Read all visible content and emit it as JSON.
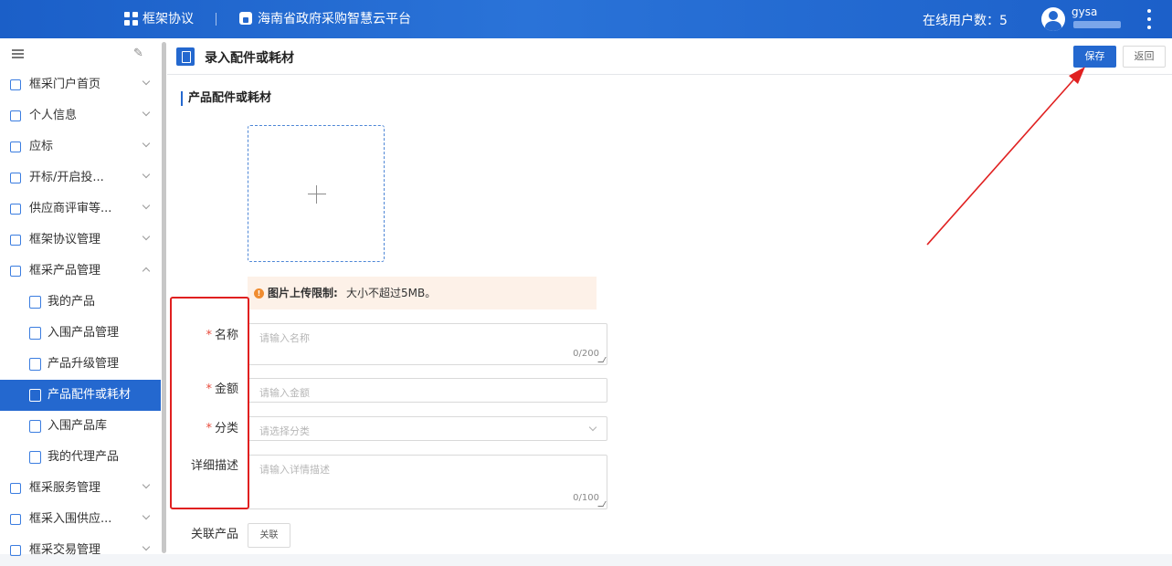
{
  "topbar": {
    "app_name": "框架协议",
    "platform_name": "海南省政府采购智慧云平台",
    "online_users": "在线用户数：5",
    "username": "gysa"
  },
  "sidebar": {
    "items": [
      {
        "label": "框采门户首页",
        "icon": "home-grid-icon"
      },
      {
        "label": "个人信息",
        "icon": "user-card-icon"
      },
      {
        "label": "应标",
        "icon": "bid-icon"
      },
      {
        "label": "开标/开启投...",
        "icon": "open-bid-icon"
      },
      {
        "label": "供应商评审等...",
        "icon": "review-icon"
      },
      {
        "label": "框架协议管理",
        "icon": "agreement-icon"
      },
      {
        "label": "框采产品管理",
        "icon": "product-icon"
      }
    ],
    "subitems": [
      {
        "label": "我的产品",
        "icon": "my-product-icon"
      },
      {
        "label": "入围产品管理",
        "icon": "shortlist-manage-icon"
      },
      {
        "label": "产品升级管理",
        "icon": "upgrade-icon"
      },
      {
        "label": "产品配件或耗材",
        "icon": "accessory-icon"
      },
      {
        "label": "入围产品库",
        "icon": "library-icon"
      },
      {
        "label": "我的代理产品",
        "icon": "agent-icon"
      }
    ],
    "bottom_items": [
      {
        "label": "框采服务管理",
        "icon": "service-icon"
      },
      {
        "label": "框采入围供应...",
        "icon": "supplier-icon"
      },
      {
        "label": "框采交易管理",
        "icon": "trade-icon"
      }
    ]
  },
  "page": {
    "title": "录入配件或耗材",
    "save_label": "保存",
    "back_label": "返回",
    "section_title": "产品配件或耗材"
  },
  "notice": {
    "title": "图片上传限制:",
    "text": "大小不超过5MB。"
  },
  "form": {
    "name_label": "名称",
    "name_placeholder": "请输入名称",
    "name_count": "0/200",
    "amount_label": "金额",
    "amount_placeholder": "请输入金额",
    "category_label": "分类",
    "category_placeholder": "请选择分类",
    "desc_label": "详细描述",
    "desc_placeholder": "请输入详情描述",
    "desc_count": "0/100",
    "related_label": "关联产品",
    "related_button": "关联"
  },
  "colors": {
    "primary": "#2468cf",
    "required": "#e84c3d",
    "annotation": "#e02020",
    "notice_bg": "#fdf1e8"
  }
}
